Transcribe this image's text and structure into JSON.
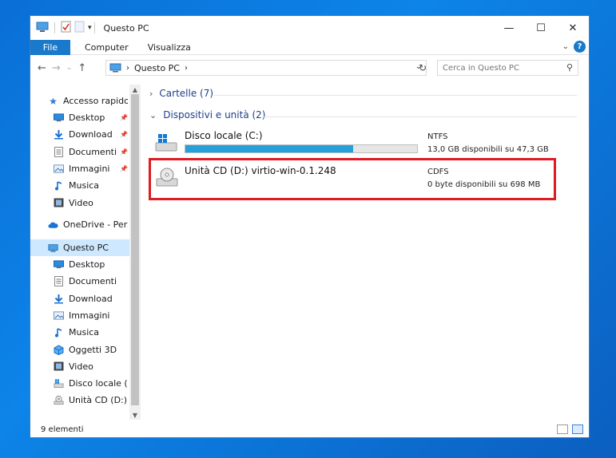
{
  "window": {
    "title": "Questo PC"
  },
  "ribbon": {
    "tabs": [
      "File",
      "Computer",
      "Visualizza"
    ]
  },
  "address": {
    "path": "Questo PC",
    "search_placeholder": "Cerca in Questo PC"
  },
  "sidebar": {
    "quick_access": "Accesso rapido",
    "quick_items": [
      {
        "label": "Desktop",
        "icon": "desktop-icon"
      },
      {
        "label": "Download",
        "icon": "download-icon"
      },
      {
        "label": "Documenti",
        "icon": "documents-icon"
      },
      {
        "label": "Immagini",
        "icon": "pictures-icon"
      },
      {
        "label": "Musica",
        "icon": "music-icon"
      },
      {
        "label": "Video",
        "icon": "video-icon"
      }
    ],
    "onedrive": "OneDrive - Person",
    "this_pc": "Questo PC",
    "pc_items": [
      {
        "label": "Desktop",
        "icon": "desktop-icon"
      },
      {
        "label": "Documenti",
        "icon": "documents-icon"
      },
      {
        "label": "Download",
        "icon": "download-icon"
      },
      {
        "label": "Immagini",
        "icon": "pictures-icon"
      },
      {
        "label": "Musica",
        "icon": "music-icon"
      },
      {
        "label": "Oggetti 3D",
        "icon": "3d-objects-icon"
      },
      {
        "label": "Video",
        "icon": "video-icon"
      },
      {
        "label": "Disco locale (C:)",
        "icon": "drive-icon"
      },
      {
        "label": "Unità CD (D:) virt",
        "icon": "cd-drive-icon"
      }
    ]
  },
  "content": {
    "folders_group": "Cartelle (7)",
    "devices_group": "Dispositivi e unità (2)",
    "drives": [
      {
        "name": "Disco locale (C:)",
        "fs": "NTFS",
        "space": "13,0 GB disponibili su 47,3 GB",
        "used_fraction": 0.725
      },
      {
        "name": "Unità CD (D:) virtio-win-0.1.248",
        "fs": "CDFS",
        "space": "0 byte disponibili su 698 MB"
      }
    ]
  },
  "status": {
    "count": "9 elementi"
  },
  "colors": {
    "accent": "#1979ca",
    "highlight": "#e01b24",
    "bar": "#26a0da"
  }
}
